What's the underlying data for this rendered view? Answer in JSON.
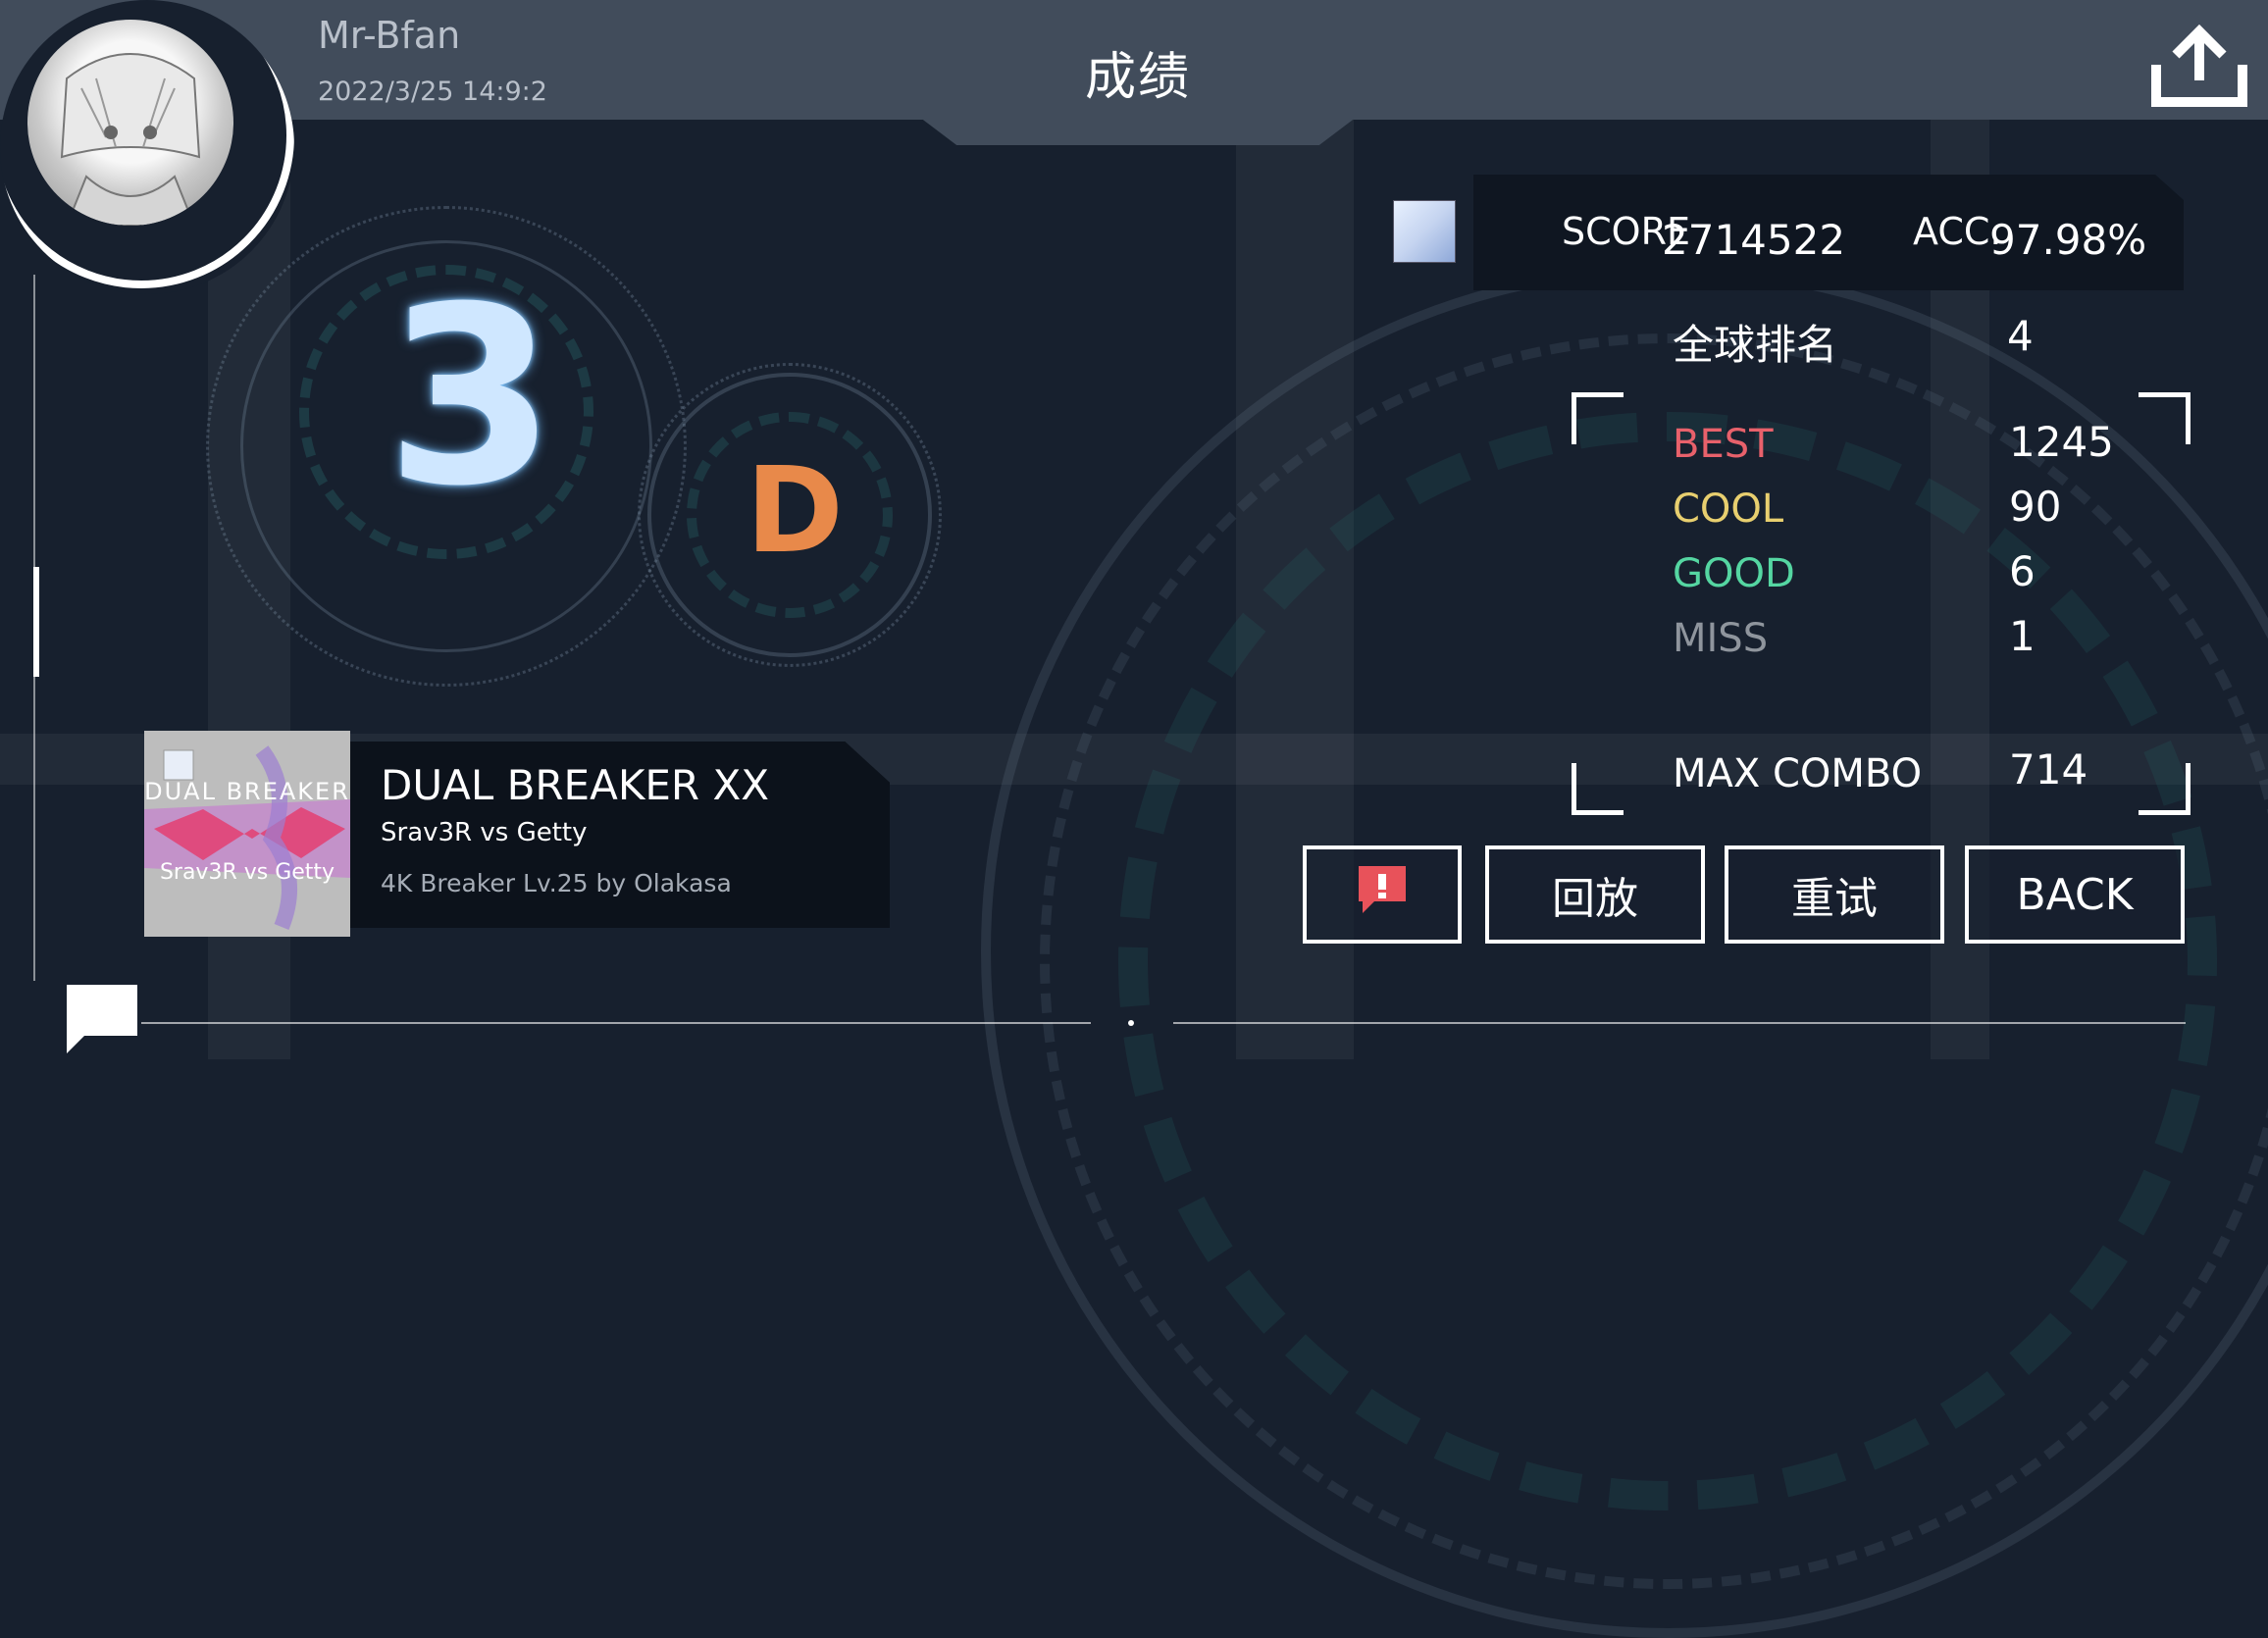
{
  "header": {
    "title": "成绩",
    "username": "Mr-Bfan",
    "datetime": "2022/3/25 14:9:2"
  },
  "result": {
    "rank": "3",
    "grade": "D"
  },
  "score": {
    "score_label": "SCORE",
    "score_value": "2714522",
    "acc_label": "ACC.",
    "acc_value": "97.98%"
  },
  "stats": {
    "global_rank_label": "全球排名",
    "global_rank_value": "4",
    "judgements": [
      {
        "label": "BEST",
        "value": "1245",
        "color": "#e8616b"
      },
      {
        "label": "COOL",
        "value": "90",
        "color": "#e8cf6f"
      },
      {
        "label": "GOOD",
        "value": "6",
        "color": "#55d6a2"
      },
      {
        "label": "MISS",
        "value": "1",
        "color": "#8f959d"
      }
    ],
    "max_combo_label": "MAX COMBO",
    "max_combo_value": "714"
  },
  "song": {
    "title": "DUAL BREAKER XX",
    "artist": "Srav3R vs Getty",
    "chart_info": "4K Breaker  Lv.25 by Olakasa",
    "art_text_top": "DUAL BREAKER",
    "art_text_bottom": "Srav3R vs Getty"
  },
  "actions": {
    "report_icon": "report-exclamation-icon",
    "replay_label": "回放",
    "retry_label": "重试",
    "back_label": "BACK"
  },
  "icons": {
    "upload": "upload-share-icon",
    "chat": "chat-bubble-icon"
  },
  "colors": {
    "background": "#17202e",
    "topbar": "#414c5b",
    "rank_glow": "#6fb4ef",
    "grade": "#e8894a",
    "report_red": "#e8525a"
  }
}
